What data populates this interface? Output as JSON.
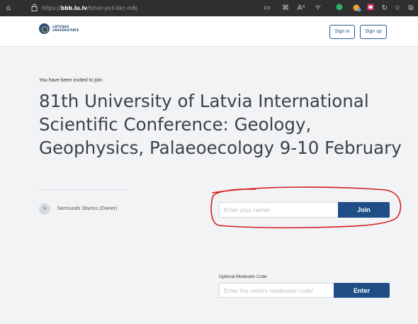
{
  "browser": {
    "url_protocol": "https://",
    "url_domain": "bbb.lu.lv",
    "url_path": "/b/nor-yo3-bkc-m6j",
    "icons": [
      "home-icon",
      "lock-icon",
      "reader-view-icon",
      "app-grid-icon",
      "read-aloud-icon",
      "translate-icon",
      "extension-icon",
      "extension-icon",
      "extension-icon",
      "refresh-icon",
      "favorites-icon",
      "collections-icon"
    ]
  },
  "header": {
    "logo_line1": "LATVIJAS",
    "logo_line2": "UNIVERSITĀTE",
    "sign_in": "Sign in",
    "sign_up": "Sign up"
  },
  "room": {
    "invite_label": "You have been invited to join",
    "title": "81th University of Latvia International Scientific Conference: Geology, Geophysics, Palaeoecology 9-10 February",
    "owner_initial": "N",
    "owner_name": "Normunds Stivrins (Owner)"
  },
  "join": {
    "name_placeholder": "Enter your name!",
    "join_label": "Join"
  },
  "moderator": {
    "label": "Optional Moderator Code:",
    "code_placeholder": "Enter the room's moderator code!",
    "enter_label": "Enter"
  },
  "colors": {
    "primary": "#1f4e87",
    "annotation": "#d42020"
  }
}
